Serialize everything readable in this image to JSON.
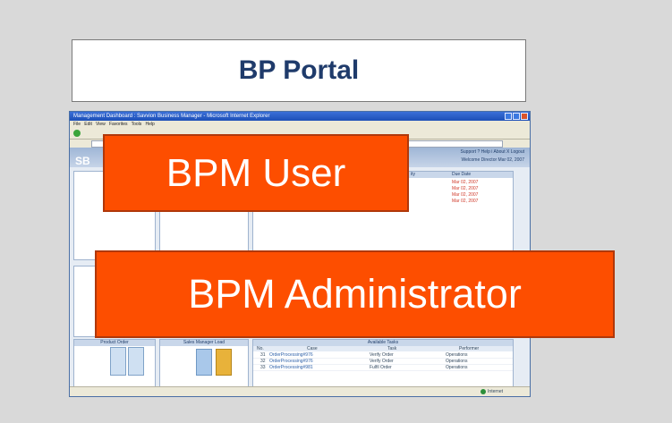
{
  "title": "BP Portal",
  "callouts": {
    "user": "BPM User",
    "admin": "BPM Administrator"
  },
  "screenshot": {
    "window_title": "Management Dashboard : Savvion Business Manager - Microsoft Internet Explorer",
    "menu": [
      "File",
      "Edit",
      "View",
      "Favorites",
      "Tools",
      "Help"
    ],
    "logo": "SB",
    "header_links": "Support   ? Help   i About   X Logout",
    "welcome": "Welcome Director  Mar 02, 2007",
    "due_header": "Due Date",
    "activity_header": "ity",
    "due_dates": [
      "Mar 02, 2007",
      "Mar 02, 2007",
      "Mar 02, 2007",
      "Mar 02, 2007"
    ],
    "panels": {
      "bottom_left": "Product Order",
      "bottom_mid": "Sales Manager Load",
      "bottom_right": "Available Tasks"
    },
    "tasks_columns": [
      "No.",
      "Case",
      "Task",
      "Performer"
    ],
    "tasks_rows": [
      [
        "31",
        "OrderProcessing#976",
        "Verify Order",
        "Operations"
      ],
      [
        "32",
        "OrderProcessing#976",
        "Verify Order",
        "Operations"
      ],
      [
        "33",
        "OrderProcessing#981",
        "Fulfil Order",
        "Operations"
      ]
    ],
    "status_zone": "Internet",
    "colors": {
      "callout": "#fd4e00",
      "title_text": "#1f3b6b",
      "background": "#d9d9d9"
    }
  }
}
